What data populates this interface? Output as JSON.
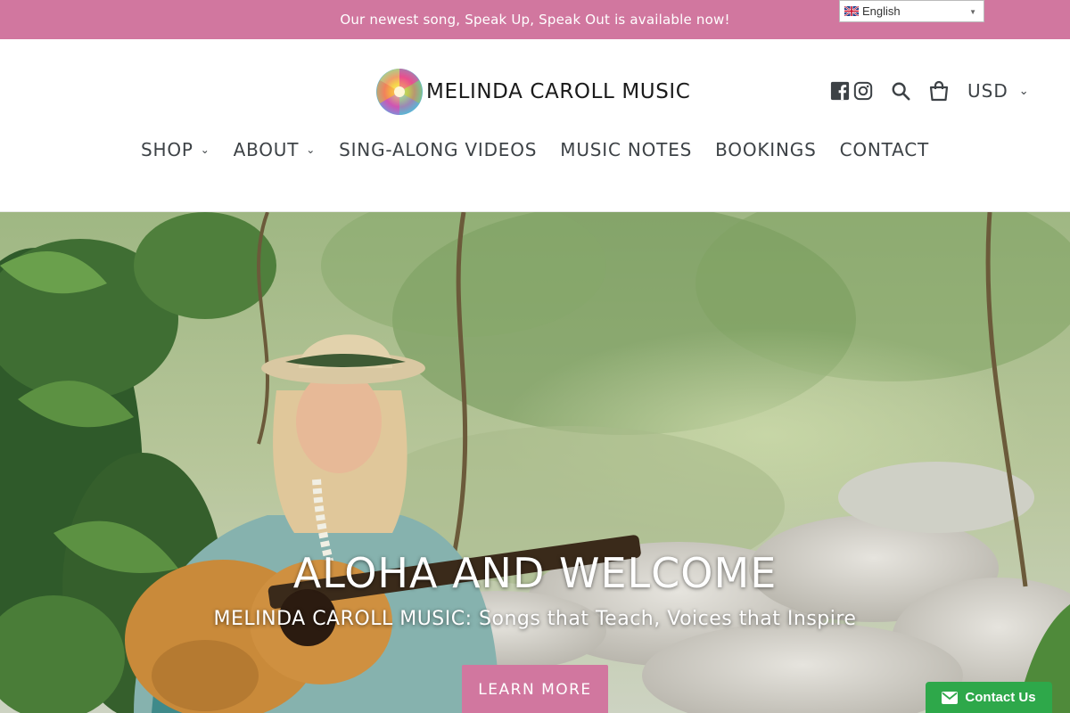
{
  "announcement": {
    "text": "Our newest song, Speak Up, Speak Out is available now!"
  },
  "language_selector": {
    "selected": "English",
    "icon": "uk-flag-icon"
  },
  "brand": {
    "name": "MELINDA CAROLL MUSIC",
    "icon": "tie-dye-logo"
  },
  "header_icons": {
    "facebook": "facebook-icon",
    "instagram": "instagram-icon",
    "search": "search-icon",
    "cart": "cart-icon",
    "currency": "USD"
  },
  "nav": {
    "items": [
      {
        "label": "SHOP",
        "dropdown": true
      },
      {
        "label": "ABOUT",
        "dropdown": true
      },
      {
        "label": "SING-ALONG VIDEOS",
        "dropdown": false
      },
      {
        "label": "MUSIC NOTES",
        "dropdown": false
      },
      {
        "label": "BOOKINGS",
        "dropdown": false
      },
      {
        "label": "CONTACT",
        "dropdown": false
      }
    ]
  },
  "hero": {
    "title": "ALOHA AND WELCOME",
    "subtitle": "MELINDA CAROLL MUSIC: Songs that Teach, Voices that Inspire",
    "button": "LEARN MORE"
  },
  "contact_widget": {
    "label": "Contact Us",
    "icon": "envelope-icon"
  },
  "colors": {
    "accent": "#d1779f",
    "contact_green": "#2ea84a",
    "text": "#3d4246"
  }
}
